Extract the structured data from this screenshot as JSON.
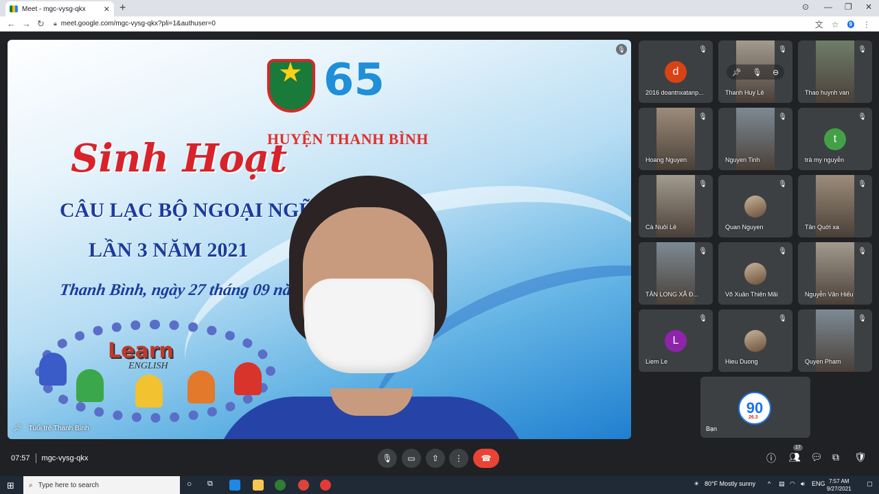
{
  "browser": {
    "tab_title": "Meet - mgc-vysg-qkx",
    "tab_close": "✕",
    "new_tab": "+",
    "url": "meet.google.com/mgc-vysg-qkx?pli=1&authuser=0",
    "extension_badge": "9"
  },
  "stage": {
    "banner": {
      "anniversary": "65",
      "district": "HUYỆN THANH BÌNH",
      "title": "Sinh Hoạt",
      "club": "CÂU LẠC BỘ NGOẠI NGỮ",
      "session": "LẦN 3 NĂM 2021",
      "date_line": "Thanh Bình, ngày 27 tháng 09 năm 2021",
      "logo_learn": "Learn",
      "logo_english": "ENGLISH"
    },
    "presenter_name": "Tuổi trẻ Thanh Bình"
  },
  "participants": [
    {
      "name": "2016 doantnxatanp...",
      "avatar": "letter",
      "letter": "d",
      "color": "#d84315"
    },
    {
      "name": "Thanh Huy Lê",
      "avatar": "video",
      "hovered": true
    },
    {
      "name": "Thao huynh van",
      "avatar": "video"
    },
    {
      "name": "Hoang Nguyen",
      "avatar": "video"
    },
    {
      "name": "Nguyen Tinh",
      "avatar": "video"
    },
    {
      "name": "trà my nguyễn",
      "avatar": "letter",
      "letter": "t",
      "color": "#43a047"
    },
    {
      "name": "Cà Nuôi Lê",
      "avatar": "video"
    },
    {
      "name": "Quan Nguyen",
      "avatar": "photo"
    },
    {
      "name": "Tân Quới xa",
      "avatar": "video"
    },
    {
      "name": "TÂN LONG XÃ Đ...",
      "avatar": "video"
    },
    {
      "name": "Võ Xuân Thiên Mãi",
      "avatar": "photo"
    },
    {
      "name": "Nguyễn Văn Hiếu",
      "avatar": "video"
    },
    {
      "name": "Liem Le",
      "avatar": "letter",
      "letter": "L",
      "color": "#8e24aa"
    },
    {
      "name": "Hieu Duong",
      "avatar": "photo"
    },
    {
      "name": "Quyen Pham",
      "avatar": "video"
    }
  ],
  "self_tile": {
    "name": "Bạn",
    "logo_text": "90",
    "logo_sub": "26.3"
  },
  "controls": {
    "time": "07:57",
    "meeting_code": "mgc-vysg-qkx",
    "people_count": "17"
  },
  "taskbar": {
    "search_placeholder": "Type here to search",
    "weather": "80°F  Mostly sunny",
    "language": "ENG",
    "time": "7:57 AM",
    "date": "9/27/2021"
  },
  "colors": {
    "end_call": "#ea4335",
    "meet_bg": "#202124",
    "tile_bg": "#3c4043"
  }
}
